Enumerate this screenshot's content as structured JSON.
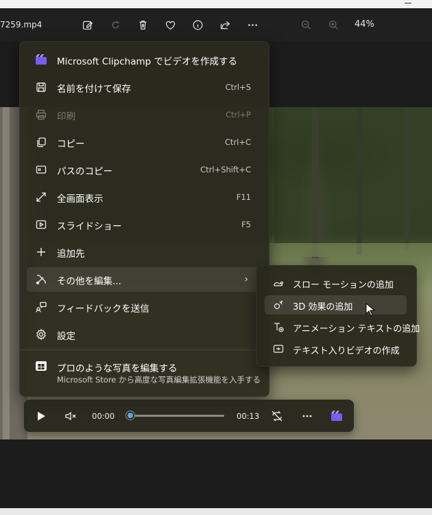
{
  "window": {
    "filename": "7259.mp4",
    "zoom_level": "44%"
  },
  "toolbar_icons": [
    "edit-icon",
    "rotate-icon",
    "delete-icon",
    "favorite-icon",
    "info-icon",
    "share-icon",
    "more-icon",
    "zoom-out-icon",
    "zoom-in-icon"
  ],
  "context_menu": {
    "items": [
      {
        "label": "Microsoft Clipchamp でビデオを作成する",
        "shortcut": "",
        "icon": "clipchamp-icon"
      },
      {
        "label": "名前を付けて保存",
        "shortcut": "Ctrl+S",
        "icon": "save-icon"
      },
      {
        "label": "印刷",
        "shortcut": "Ctrl+P",
        "icon": "print-icon",
        "disabled": true
      },
      {
        "label": "コピー",
        "shortcut": "Ctrl+C",
        "icon": "copy-icon"
      },
      {
        "label": "パスのコピー",
        "shortcut": "Ctrl+Shift+C",
        "icon": "copy-path-icon"
      },
      {
        "label": "全画面表示",
        "shortcut": "F11",
        "icon": "fullscreen-icon"
      },
      {
        "label": "スライドショー",
        "shortcut": "F5",
        "icon": "slideshow-icon"
      },
      {
        "label": "追加先",
        "shortcut": "",
        "icon": "add-icon"
      },
      {
        "label": "その他を編集...",
        "shortcut": "",
        "icon": "edit-more-icon",
        "highlighted": true
      },
      {
        "label": "フィードバックを送信",
        "shortcut": "",
        "icon": "feedback-icon"
      },
      {
        "label": "設定",
        "shortcut": "",
        "icon": "settings-icon"
      }
    ],
    "promo": {
      "title": "プロのような写真を編集する",
      "subtitle": "Microsoft Store から高度な写真編集拡張機能を入手する"
    }
  },
  "submenu": {
    "items": [
      {
        "label": "スロー モーションの追加",
        "icon": "slow-motion-icon"
      },
      {
        "label": "3D 効果の追加",
        "icon": "3d-effects-icon",
        "highlighted": true
      },
      {
        "label": "アニメーション テキストの追加",
        "icon": "animated-text-icon"
      },
      {
        "label": "テキスト入りビデオの作成",
        "icon": "video-text-icon"
      }
    ]
  },
  "player": {
    "current_time": "00:00",
    "total_time": "00:13",
    "progress": 0.0
  }
}
